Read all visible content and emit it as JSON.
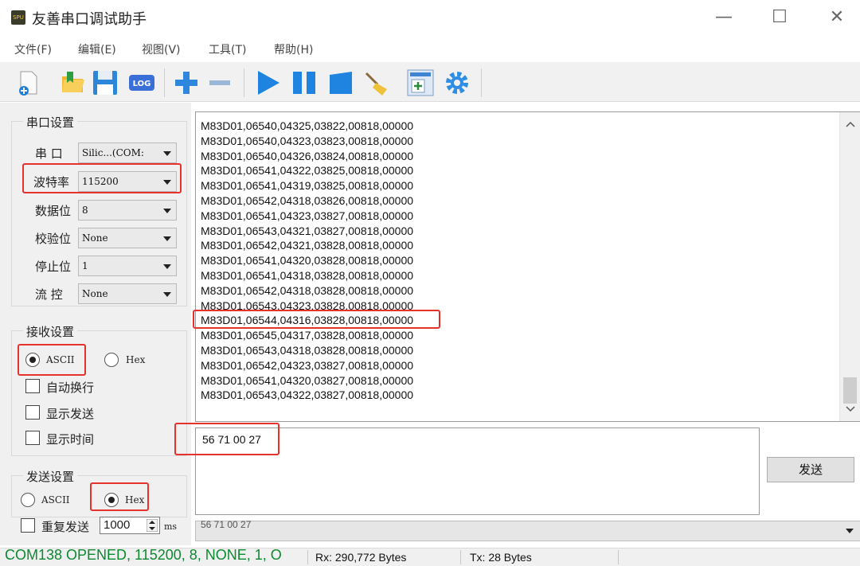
{
  "window": {
    "title": "友善串口调试助手",
    "app_icon_text": "SPU",
    "min_glyph": "—",
    "max_glyph": "☐",
    "close_glyph": "✕"
  },
  "menu": {
    "items": [
      "文件(F)",
      "编辑(E)",
      "视图(V)",
      "工具(T)",
      "帮助(H)"
    ]
  },
  "toolbar": {
    "icons": [
      "new-file-icon",
      "open-folder-icon",
      "save-disk-icon",
      "log-icon",
      "add-plus-icon",
      "remove-minus-icon",
      "play-icon",
      "pause-icon",
      "stop-icon",
      "clear-broom-icon",
      "new-window-icon",
      "settings-gear-icon"
    ],
    "log_text": "LOG"
  },
  "serial_settings": {
    "group_title": "串口设置",
    "port_label": "串 口",
    "port_value": "Silic...(COM:",
    "baud_label": "波特率",
    "baud_value": "115200",
    "databits_label": "数据位",
    "databits_value": "8",
    "parity_label": "校验位",
    "parity_value": "None",
    "stopbits_label": "停止位",
    "stopbits_value": "1",
    "flow_label": "流 控",
    "flow_value": "None"
  },
  "receive_settings": {
    "group_title": "接收设置",
    "ascii_label": "ASCII",
    "hex_label": "Hex",
    "selected": "ASCII",
    "auto_wrap_label": "自动换行",
    "show_send_label": "显示发送",
    "show_time_label": "显示时间"
  },
  "send_settings": {
    "group_title": "发送设置",
    "ascii_label": "ASCII",
    "hex_label": "Hex",
    "selected": "Hex",
    "repeat_label": "重复发送",
    "repeat_interval": "1000",
    "unit_label": "ms"
  },
  "receive_lines": [
    "M83D01,06540,04325,03822,00818,00000",
    "M83D01,06540,04323,03823,00818,00000",
    "M83D01,06540,04326,03824,00818,00000",
    "M83D01,06541,04322,03825,00818,00000",
    "M83D01,06541,04319,03825,00818,00000",
    "M83D01,06542,04318,03826,00818,00000",
    "M83D01,06541,04323,03827,00818,00000",
    "M83D01,06543,04321,03827,00818,00000",
    "M83D01,06542,04321,03828,00818,00000",
    "M83D01,06541,04320,03828,00818,00000",
    "M83D01,06541,04318,03828,00818,00000",
    "M83D01,06542,04318,03828,00818,00000",
    "M83D01,06543,04323,03828,00818,00000",
    "M83D01,06544,04316,03828,00818,00000",
    "M83D01,06545,04317,03828,00818,00000",
    "M83D01,06543,04318,03828,00818,00000",
    "M83D01,06542,04323,03827,00818,00000",
    "M83D01,06541,04320,03827,00818,00000",
    "M83D01,06543,04322,03827,00818,00000"
  ],
  "highlighted_line": "M83D01,06544,04316,03828,00818,00000",
  "send_area": {
    "text": "56 71 00 27",
    "send_button": "发送",
    "history_text": "56 71 00 27"
  },
  "status": {
    "main": "COM138 OPENED, 115200, 8, NONE, 1, O",
    "rx": "Rx: 290,772 Bytes",
    "tx": "Tx: 28 Bytes"
  },
  "colors": {
    "highlight_red": "#e5322d",
    "status_green": "#0b8a2f",
    "toolbar_blue": "#1f7fd6"
  }
}
